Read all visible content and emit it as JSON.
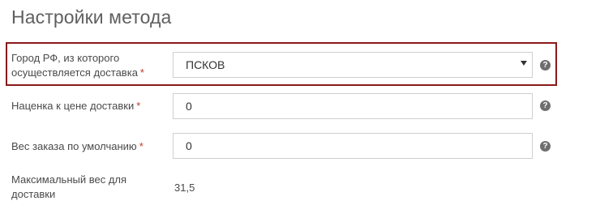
{
  "section": {
    "title": "Настройки метода"
  },
  "fields": {
    "city": {
      "label": "Город РФ, из которого осуществляется доставка",
      "required_mark": "*",
      "value": "ПСКОВ",
      "help_glyph": "?"
    },
    "markup": {
      "label": "Наценка к цене доставки",
      "required_mark": "*",
      "value": "0",
      "help_glyph": "?"
    },
    "default_weight": {
      "label": "Вес заказа по умолчанию",
      "required_mark": "*",
      "value": "0",
      "help_glyph": "?"
    },
    "max_weight": {
      "label": "Максимальный вес для доставки",
      "value": "31,5"
    }
  },
  "colors": {
    "highlight_border": "#8b1a1a",
    "required_star": "#c0392b",
    "input_border": "#cfcfcf",
    "help_icon_bg": "#6e6e6e"
  },
  "icons": {
    "help": "question-circle-icon",
    "select_arrow": "caret-down-icon"
  }
}
